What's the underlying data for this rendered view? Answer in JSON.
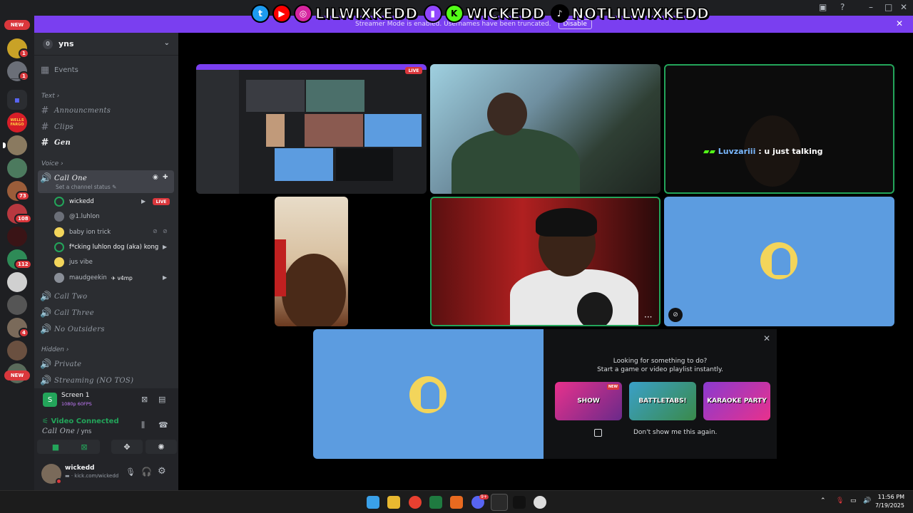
{
  "overlay": {
    "handles": [
      "LILWIXKEDD",
      "WICKEDD",
      "NOTLILWIXKEDD"
    ]
  },
  "streamer_banner": {
    "text": "Streamer Mode is enabled. Usernames have been truncated.",
    "disable_label": "Disable"
  },
  "rail": {
    "new_badge_top": "NEW",
    "new_badge_bottom": "NEW",
    "server_badges": [
      "1",
      "1",
      "73",
      "108",
      "112",
      "4"
    ],
    "wells_label": "WELLS FARGO"
  },
  "sidebar": {
    "guild_name": "yns",
    "guild_icon": "0",
    "events_label": "Events",
    "text_category": "Text",
    "text_channels": [
      "Announcments",
      "Clips",
      "Gen"
    ],
    "voice_category": "Voice",
    "call_one": "Call One",
    "channel_status": "Set a channel status",
    "voice_users": [
      {
        "name": "wickedd",
        "live": "LIVE"
      },
      {
        "name": "@1.luhlon"
      },
      {
        "name": "baby ion trick"
      },
      {
        "name": "f*cking luhlon dog (aka) kong"
      },
      {
        "name": "jus vibe"
      },
      {
        "name": "maudgeekin",
        "tag": "v4mp"
      }
    ],
    "voice_channels": [
      "Call Two",
      "Call Three",
      "No Outsiders"
    ],
    "hidden_category": "Hidden",
    "hidden_channels": [
      "Private",
      "Streaming (NO TOS)"
    ]
  },
  "screen_panel": {
    "title": "Screen 1",
    "quality": "1080p 60FPS"
  },
  "connection": {
    "status": "Video Connected",
    "channel": "Call One",
    "separator": "/",
    "guild": "yns"
  },
  "user": {
    "name": "wickedd",
    "status": "kick.com/wickedd"
  },
  "stage": {
    "live_label": "LIVE",
    "chat_name": "Luvzariii",
    "chat_text": ": u just talking",
    "more_label": "···"
  },
  "activity": {
    "line1": "Looking for something to do?",
    "line2": "Start a game or video playlist instantly.",
    "games": [
      "SHOW",
      "BATTLETABS!",
      "KARAOKE PARTY"
    ],
    "game_new": "NEW",
    "dont_show": "Don't show me this again."
  },
  "taskbar": {
    "time": "11:56 PM",
    "date": "7/19/2025",
    "discord_badge": "9+"
  },
  "colors": {
    "accent": "#5865f2",
    "banner": "#7a3ff0",
    "live": "#da373c",
    "connected": "#23a55a",
    "tile_blue": "#5c9ce0"
  }
}
